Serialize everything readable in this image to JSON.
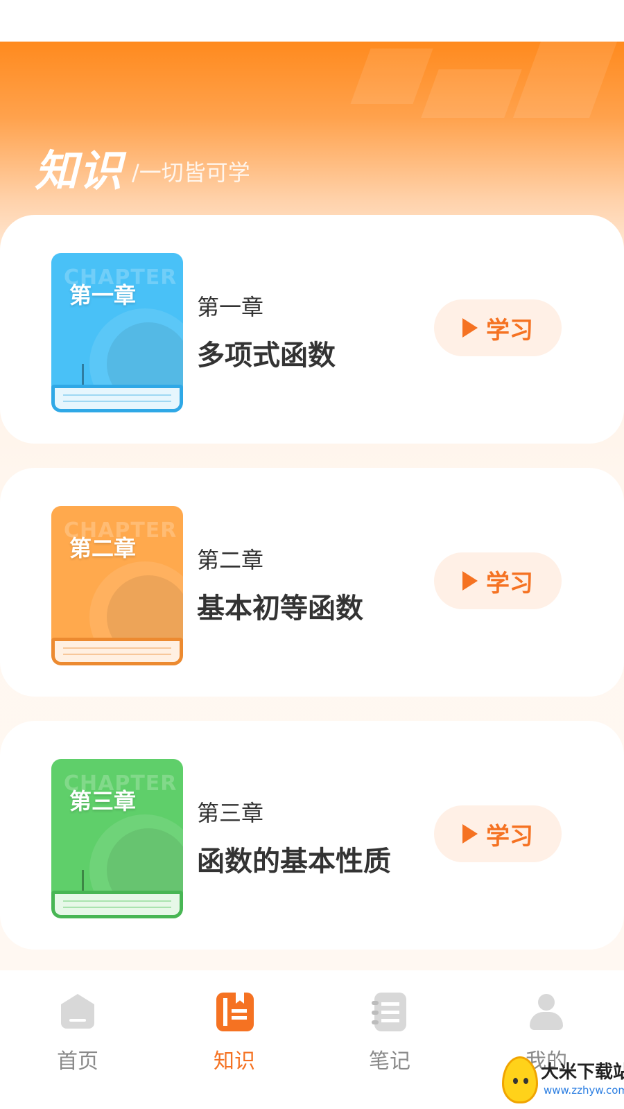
{
  "header": {
    "title": "知识",
    "subtitle": "/一切皆可学"
  },
  "chapters": [
    {
      "cover_watermark": "CHAPTER",
      "cover_title": "第一章",
      "label": "第一章",
      "name": "多项式函数",
      "button_label": "学习",
      "cover_color": "#49c1f7"
    },
    {
      "cover_watermark": "CHAPTER",
      "cover_title": "第二章",
      "label": "第二章",
      "name": "基本初等函数",
      "button_label": "学习",
      "cover_color": "#ffa94d"
    },
    {
      "cover_watermark": "CHAPTER",
      "cover_title": "第三章",
      "label": "第三章",
      "name": "函数的基本性质",
      "button_label": "学习",
      "cover_color": "#5fcf6a"
    }
  ],
  "tabbar": {
    "items": [
      {
        "label": "首页",
        "icon": "home-icon",
        "active": false
      },
      {
        "label": "知识",
        "icon": "knowledge-icon",
        "active": true
      },
      {
        "label": "笔记",
        "icon": "notes-icon",
        "active": false
      },
      {
        "label": "我的",
        "icon": "profile-icon",
        "active": false
      }
    ]
  },
  "watermark": {
    "site_name": "大米下载站",
    "site_url": "www.zzhyw.com"
  },
  "colors": {
    "accent": "#f57222",
    "header_gradient_top": "#ff8a1e",
    "button_bg": "#fff0e6",
    "inactive_tab": "#8a8a8a"
  }
}
